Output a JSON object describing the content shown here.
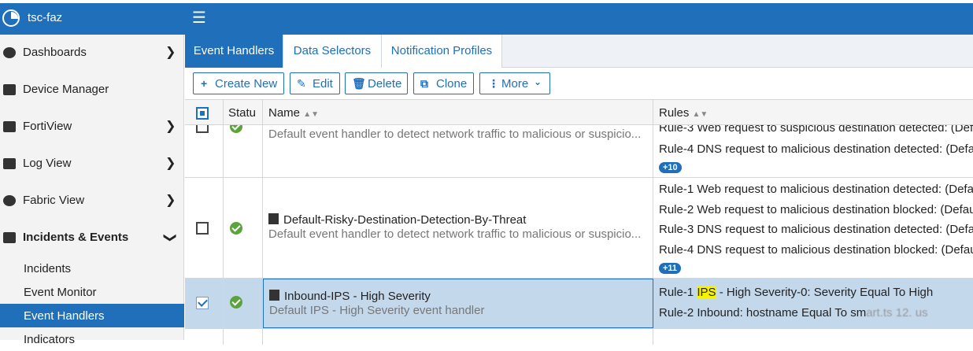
{
  "app": {
    "title": "tsc-faz"
  },
  "sidebar": {
    "items": [
      {
        "label": "Dashboards",
        "icon": "dashboard-icon"
      },
      {
        "label": "Device Manager",
        "icon": "device-manager-icon"
      },
      {
        "label": "FortiView",
        "icon": "fortiview-icon"
      },
      {
        "label": "Log View",
        "icon": "log-view-icon"
      },
      {
        "label": "Fabric View",
        "icon": "fabric-view-icon"
      },
      {
        "label": "Incidents & Events",
        "icon": "incidents-events-icon"
      }
    ],
    "subitems": [
      {
        "label": "Incidents"
      },
      {
        "label": "Event Monitor"
      },
      {
        "label": "Event Handlers",
        "active": true
      },
      {
        "label": "Indicators"
      }
    ]
  },
  "tabs": [
    {
      "label": "Event Handlers",
      "active": true
    },
    {
      "label": "Data Selectors"
    },
    {
      "label": "Notification Profiles"
    }
  ],
  "toolbar": {
    "create_new": "Create New",
    "edit": "Edit",
    "delete": "Delete",
    "clone": "Clone",
    "more": "More"
  },
  "table": {
    "columns": {
      "status": "Statu",
      "name": "Name",
      "rules": "Rules"
    },
    "rows": [
      {
        "description": "Default event handler to detect network traffic to malicious or suspicio...",
        "rules": [
          "Rule-3 Web request to suspicious destination detected: (Def",
          "Rule-4 DNS request to malicious destination detected: (Defa"
        ],
        "more": "+10"
      },
      {
        "name": "Default-Risky-Destination-Detection-By-Threat",
        "description": "Default event handler to detect network traffic to malicious or suspicio...",
        "rules": [
          "Rule-1 Web request to malicious destination detected: (Defa",
          "Rule-2 Web request to malicious destination blocked: (Defau",
          "Rule-3 DNS request to malicious destination detected: (Defa",
          "Rule-4 DNS request to malicious destination blocked: (Defau"
        ],
        "more": "+11"
      },
      {
        "name": "Inbound-IPS - High Severity",
        "description": "Default IPS - High Severity event handler",
        "rule1_prefix": "Rule-1 ",
        "rule1_highlight": "IPS",
        "rule1_suffix": " - High Severity-0: Severity Equal To High",
        "rule2_text": "Rule-2 Inbound: hostname Equal To sm",
        "rule2_blurred": "art.ts  12.  us"
      }
    ]
  }
}
